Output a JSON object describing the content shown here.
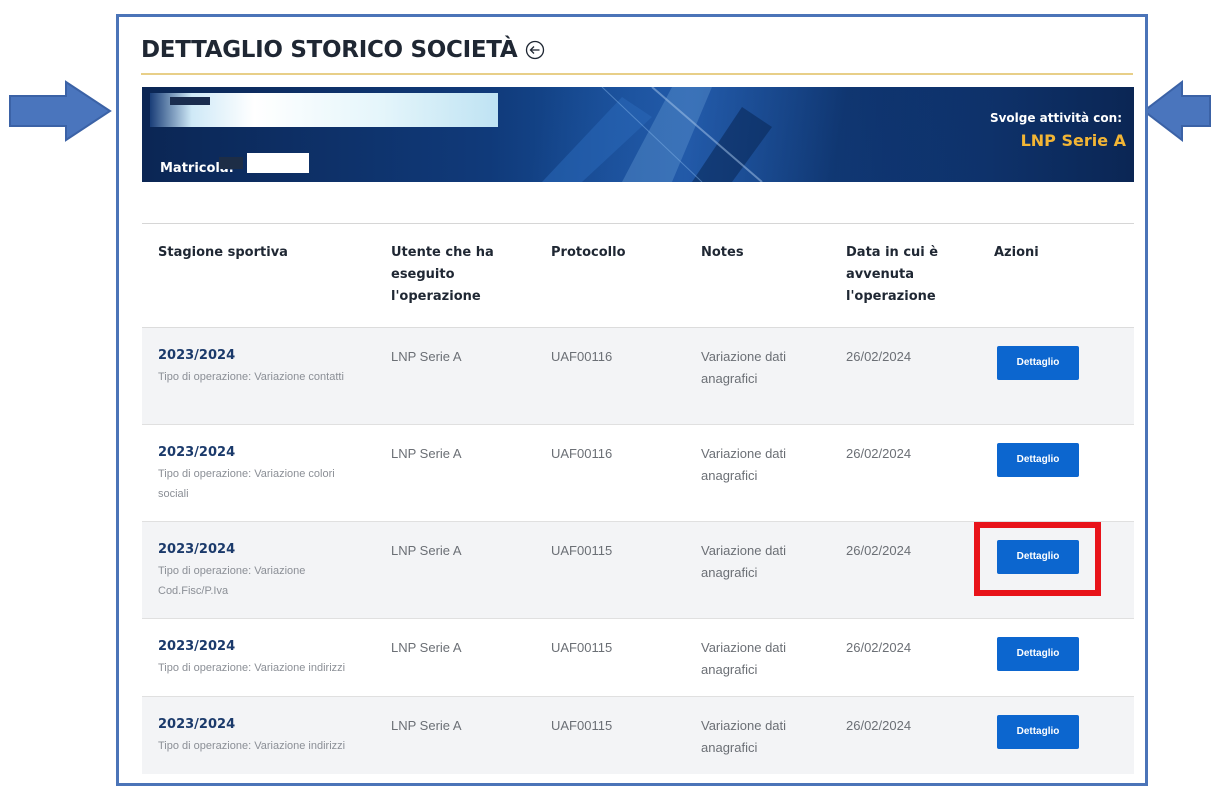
{
  "page": {
    "title": "DETTAGLIO STORICO SOCIETÀ",
    "accent_color": "#e8cf88",
    "frame_color": "#4b74b8",
    "annotation_color": "#e8131a"
  },
  "banner": {
    "matricola_label": "Matricola:",
    "activity_label": "Svolge attività con:",
    "league_name": "LNP Serie A"
  },
  "table": {
    "headers": {
      "season": "Stagione sportiva",
      "user": "Utente che ha eseguito l'operazione",
      "protocol": "Protocollo",
      "notes": "Notes",
      "date": "Data in cui è avvenuta l'operazione",
      "actions": "Azioni"
    },
    "rows": [
      {
        "season": "2023/2024",
        "op_type": "Tipo di operazione: Variazione contatti",
        "user": "LNP Serie A",
        "protocol": "UAF00116",
        "notes": "Variazione dati anagrafici",
        "date": "26/02/2024",
        "action": "Dettaglio"
      },
      {
        "season": "2023/2024",
        "op_type": "Tipo di operazione: Variazione colori sociali",
        "user": "LNP Serie A",
        "protocol": "UAF00116",
        "notes": "Variazione dati anagrafici",
        "date": "26/02/2024",
        "action": "Dettaglio"
      },
      {
        "season": "2023/2024",
        "op_type": "Tipo di operazione: Variazione Cod.Fisc/P.Iva",
        "user": "LNP Serie A",
        "protocol": "UAF00115",
        "notes": "Variazione dati anagrafici",
        "date": "26/02/2024",
        "action": "Dettaglio"
      },
      {
        "season": "2023/2024",
        "op_type": "Tipo di operazione: Variazione indirizzi",
        "user": "LNP Serie A",
        "protocol": "UAF00115",
        "notes": "Variazione dati anagrafici",
        "date": "26/02/2024",
        "action": "Dettaglio"
      },
      {
        "season": "2023/2024",
        "op_type": "Tipo di operazione: Variazione indirizzi",
        "user": "LNP Serie A",
        "protocol": "UAF00115",
        "notes": "Variazione dati anagrafici",
        "date": "26/02/2024",
        "action": "Dettaglio"
      }
    ]
  }
}
